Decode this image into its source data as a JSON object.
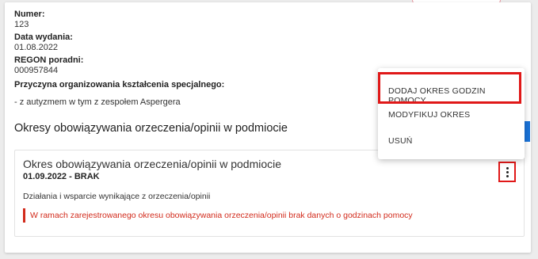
{
  "certificate": {
    "number_label": "Numer:",
    "number_value": "123",
    "issue_date_label": "Data wydania:",
    "issue_date_value": "01.08.2022",
    "regon_label": "REGON poradni:",
    "regon_value": "000957844",
    "reason_label": "Przyczyna organizowania kształcenia specjalnego:",
    "reason_value": "- z autyzmem w tym z zespołem Aspergera"
  },
  "section": {
    "title": "Okresy obowiązywania orzeczenia/opinii w podmiocie"
  },
  "period": {
    "title": "Okres obowiązywania orzeczenia/opinii w podmiocie",
    "dates": "01.09.2022 - BRAK",
    "support": "Działania i wsparcie wynikające z orzeczenia/opinii",
    "warning": "W ramach zarejestrowanego okresu obowiązywania orzeczenia/opinii brak danych o godzinach pomocy"
  },
  "menu": {
    "items": [
      {
        "label": "DODAJ OKRES GODZIN POMOCY"
      },
      {
        "label": "MODYFIKUJ OKRES"
      },
      {
        "label": "USUŃ"
      }
    ]
  },
  "colors": {
    "highlight": "#e01818",
    "warning": "#d22b1c",
    "accent": "#1a73d9"
  },
  "icons": {
    "kebab": "more-vertical-icon"
  }
}
